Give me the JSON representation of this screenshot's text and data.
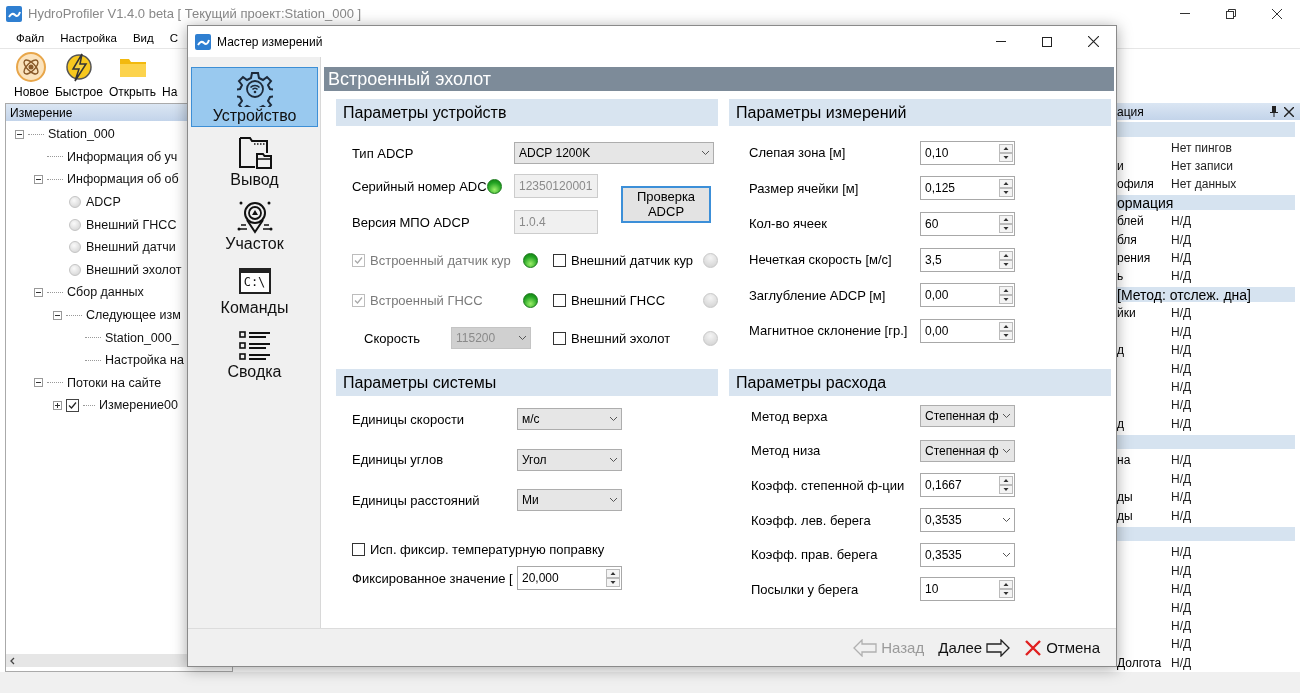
{
  "app": {
    "title": "HydroProfiler V1.4.0  beta [ Текущий проект:Station_000 ]",
    "menu": [
      "Файл",
      "Настройка",
      "Вид",
      "С"
    ],
    "toolbar": [
      {
        "label": "Новое",
        "kind": "new"
      },
      {
        "label": "Быстрое",
        "kind": "quick"
      },
      {
        "label": "Открыть",
        "kind": "open"
      },
      {
        "label": "На",
        "kind": "hidden"
      }
    ]
  },
  "tree": {
    "title": "Измерение",
    "nodes": [
      {
        "label": "Station_000",
        "kind": "plain",
        "expanded": true,
        "children": [
          {
            "label": "Информация об уч",
            "kind": "plain"
          },
          {
            "label": "Информация об об",
            "kind": "plain",
            "expanded": true,
            "children": [
              {
                "label": "ADCP",
                "kind": "status"
              },
              {
                "label": "Внешний ГНСС",
                "kind": "status"
              },
              {
                "label": "Внешний датчи",
                "kind": "status"
              },
              {
                "label": "Внешний эхолот",
                "kind": "status"
              }
            ]
          },
          {
            "label": "Сбор данных",
            "kind": "plain",
            "expanded": true,
            "children": [
              {
                "label": "Следующее изм",
                "kind": "plain",
                "expanded": true,
                "children": [
                  {
                    "label": "Station_000_",
                    "kind": "plain"
                  },
                  {
                    "label": "Настройка на",
                    "kind": "plain"
                  }
                ]
              }
            ]
          },
          {
            "label": "Потоки на сайте",
            "kind": "plain",
            "expanded": true,
            "children": [
              {
                "label": "Измерение00",
                "kind": "check",
                "checked": true,
                "expanded": false
              }
            ]
          }
        ]
      }
    ]
  },
  "info_panel": {
    "title": "ация",
    "rows": [
      {
        "kind": "section"
      },
      {
        "kind": "row",
        "value": "Нет пингов"
      },
      {
        "kind": "row",
        "label": "и",
        "value": "Нет записи"
      },
      {
        "kind": "row",
        "label": "офиля",
        "value": "Нет данных"
      },
      {
        "kind": "section",
        "label": "ормация"
      },
      {
        "kind": "row",
        "label": "блей",
        "value": "Н/Д"
      },
      {
        "kind": "row",
        "label": "бля",
        "value": "Н/Д"
      },
      {
        "kind": "row",
        "label": "рения",
        "value": "Н/Д"
      },
      {
        "kind": "row",
        "label": "ь",
        "value": "Н/Д"
      },
      {
        "kind": "section",
        "label": "[Метод: отслеж. дна]"
      },
      {
        "kind": "row",
        "label": "йки",
        "value": "Н/Д"
      },
      {
        "kind": "row",
        "value": "Н/Д"
      },
      {
        "kind": "row",
        "label": "д",
        "value": "Н/Д"
      },
      {
        "kind": "row",
        "value": "Н/Д"
      },
      {
        "kind": "row",
        "value": "Н/Д"
      },
      {
        "kind": "row",
        "value": "Н/Д"
      },
      {
        "kind": "row",
        "label": "д",
        "value": "Н/Д"
      },
      {
        "kind": "section"
      },
      {
        "kind": "row",
        "label": "на",
        "value": "Н/Д"
      },
      {
        "kind": "row",
        "value": "Н/Д"
      },
      {
        "kind": "row",
        "label": "ды",
        "value": "Н/Д"
      },
      {
        "kind": "row",
        "label": "ды",
        "value": "Н/Д"
      },
      {
        "kind": "section"
      },
      {
        "kind": "row",
        "value": "Н/Д"
      },
      {
        "kind": "row",
        "value": "Н/Д"
      },
      {
        "kind": "row",
        "value": "Н/Д"
      },
      {
        "kind": "row",
        "value": "Н/Д"
      },
      {
        "kind": "row",
        "value": "Н/Д"
      },
      {
        "kind": "row",
        "value": "Н/Д"
      },
      {
        "kind": "row",
        "label": "Долгота",
        "value": "Н/Д"
      }
    ]
  },
  "dialog": {
    "title": "Мастер измерений",
    "nav": [
      {
        "label": "Устройство",
        "kind": "device",
        "selected": true
      },
      {
        "label": "Вывод",
        "kind": "output",
        "selected": false
      },
      {
        "label": "Участок",
        "kind": "site",
        "selected": false
      },
      {
        "label": "Команды",
        "kind": "commands",
        "icon_text": "C:\\",
        "selected": false
      },
      {
        "label": "Сводка",
        "kind": "summary",
        "selected": false
      }
    ],
    "heading": "Встроенный эхолот",
    "device": {
      "title": "Параметры устройств",
      "adcp_type": {
        "label": "Тип ADCP",
        "kind": "select",
        "value": "ADCP 1200K"
      },
      "serial": {
        "label": "Серийный номер ADC",
        "kind": "text",
        "value": "12350120001",
        "disabled": true,
        "on": true
      },
      "firmware": {
        "label": "Версия МПО ADCP",
        "kind": "text",
        "value": "1.0.4",
        "disabled": true
      },
      "check_button": "Проверка ADCP",
      "builtin": [
        {
          "label": "Встроенный датчик кур",
          "checked": true,
          "disabled": true,
          "on": true
        },
        {
          "label": "Встроенный ГНСС",
          "checked": true,
          "disabled": true,
          "on": true
        }
      ],
      "baud": {
        "label": "Скорость",
        "kind": "select",
        "value": "115200",
        "disabled": true
      },
      "external": [
        {
          "label": "Внешний датчик кур",
          "checked": false,
          "disabled": false,
          "on": false
        },
        {
          "label": "Внешний ГНСС",
          "checked": false,
          "disabled": false,
          "on": false
        },
        {
          "label": "Внешний эхолот",
          "checked": false,
          "disabled": false,
          "on": false
        }
      ]
    },
    "measurement": {
      "title": "Параметры измерений",
      "fields": [
        {
          "label": "Слепая зона  [м]",
          "kind": "spin",
          "value": "0,10"
        },
        {
          "label": "Размер ячейки [м]",
          "kind": "spin",
          "value": "0,125"
        },
        {
          "label": "Кол-во ячеек",
          "kind": "spin",
          "value": "60"
        },
        {
          "label": "Нечеткая скорость [м/с]",
          "kind": "spin",
          "value": "3,5"
        },
        {
          "label": "Заглубление ADCP [м]",
          "kind": "spin",
          "value": "0,00"
        },
        {
          "label": "Магнитное склонение [гр.]",
          "kind": "spin",
          "value": "0,00"
        }
      ]
    },
    "system": {
      "title": "Параметры системы",
      "fields": [
        {
          "label": "Единицы скорости",
          "kind": "select",
          "value": "м/с"
        },
        {
          "label": "Единицы углов",
          "kind": "select",
          "value": "Угол"
        },
        {
          "label": "Единицы расстояний",
          "kind": "select",
          "value": "Ми"
        }
      ],
      "temp_correction": {
        "label": "Исп. фиксир. температурную поправку",
        "checked": false
      },
      "fixed_value": {
        "label": "Фиксированное значение [",
        "kind": "spin",
        "value": "20,000"
      }
    },
    "discharge": {
      "title": "Параметры расхода",
      "fields": [
        {
          "label": "Метод верха",
          "kind": "select",
          "value": "Степенная ф"
        },
        {
          "label": "Метод низа",
          "kind": "select",
          "value": "Степенная ф"
        },
        {
          "label": "Коэфф. степенной ф-ции",
          "kind": "spin",
          "value": "0,1667"
        },
        {
          "label": "Коэфф. лев. берега",
          "kind": "combo",
          "value": "0,3535"
        },
        {
          "label": "Коэфф. прав. берега",
          "kind": "combo",
          "value": "0,3535"
        },
        {
          "label": "Посылки у берега",
          "kind": "spin",
          "value": "10"
        }
      ]
    },
    "footer": {
      "back": {
        "label": "Назад",
        "disabled": true
      },
      "next": "Далее",
      "cancel": "Отмена"
    }
  }
}
